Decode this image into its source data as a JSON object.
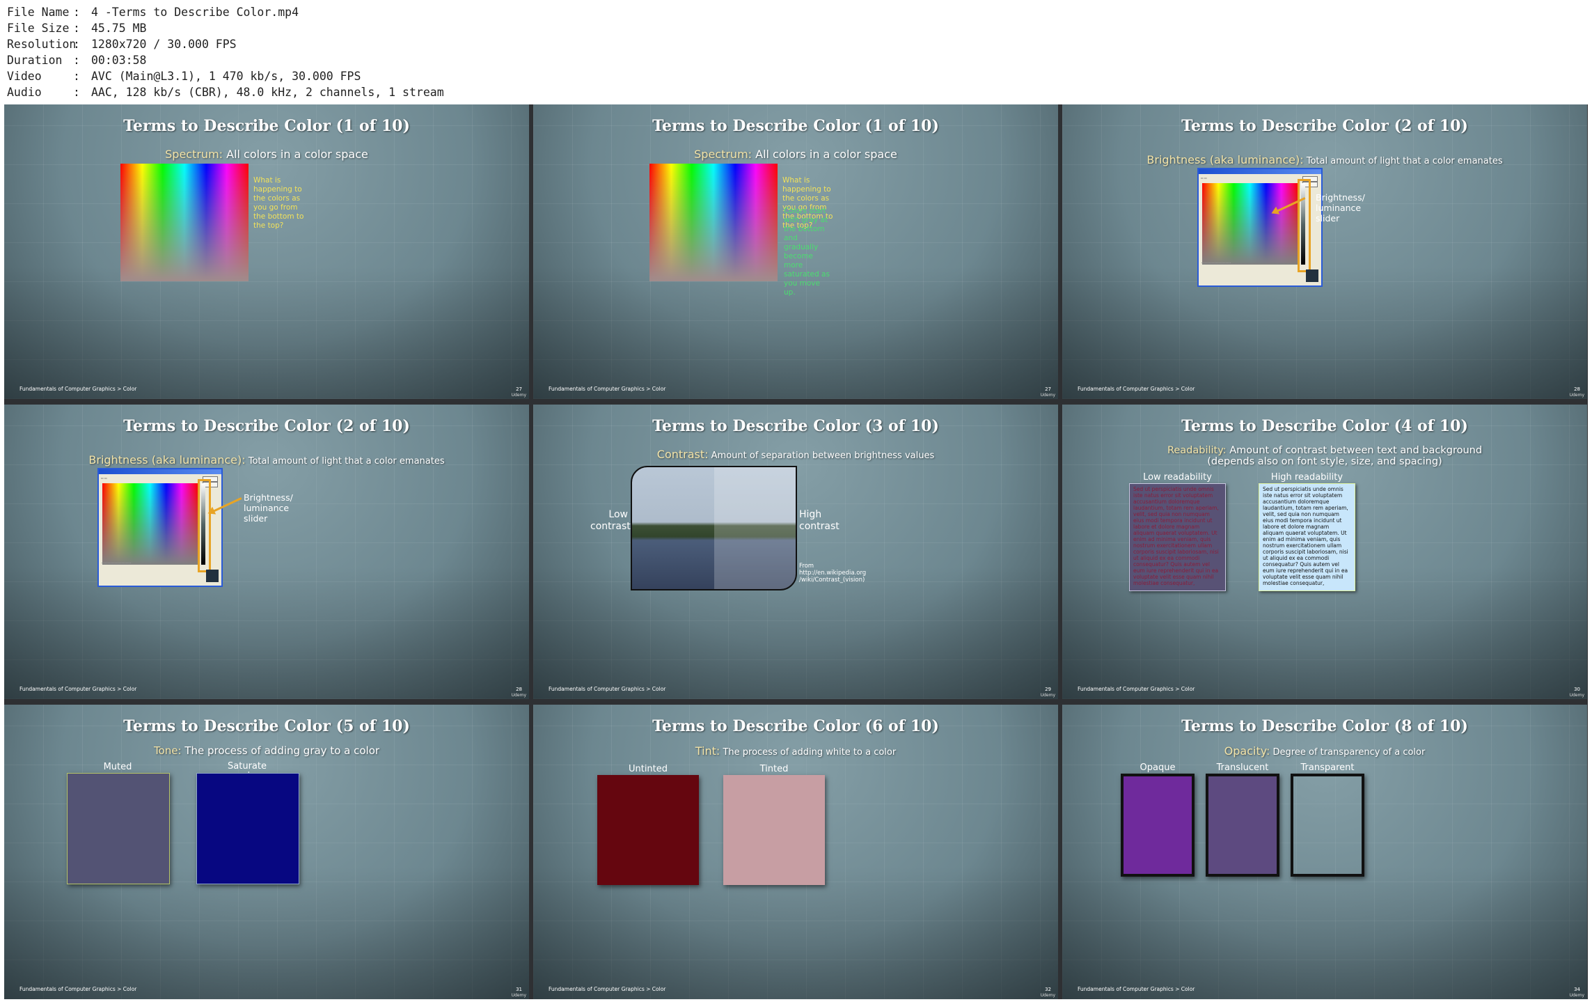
{
  "file_info": [
    {
      "key": "File Name",
      "value": "4 -Terms to Describe Color.mp4"
    },
    {
      "key": "File Size",
      "value": "45.75 MB"
    },
    {
      "key": "Resolution",
      "value": "1280x720 / 30.000 FPS"
    },
    {
      "key": "Duration",
      "value": "00:03:58"
    },
    {
      "key": "Video",
      "value": "AVC (Main@L3.1), 1 470 kb/s, 30.000 FPS"
    },
    {
      "key": "Audio",
      "value": "AAC, 128 kb/s (CBR), 48.0 kHz, 2 channels, 1 stream"
    }
  ],
  "footer": "Fundamentals of Computer Graphics > Color",
  "brand": "Udemy",
  "slides": [
    {
      "title": "Terms to Describe Color (1 of 10)",
      "term": "Spectrum:",
      "desc": " All colors in a color space",
      "question": "What is happening to the colors as you go from the bottom to the top?",
      "page": "27"
    },
    {
      "title": "Terms to Describe Color (1 of 10)",
      "term": "Spectrum:",
      "desc": " All colors in a color space",
      "question": "What is happening to the colors as you go from the bottom to the top?",
      "answer": "Colors start with gray at the bottom and gradually become more saturated as you move up.",
      "page": "27"
    },
    {
      "title": "Terms to Describe Color (2 of 10)",
      "term": "Brightness (aka luminance):",
      "desc": " Total amount of light that a color emanates",
      "callout": "Brightness/ luminance slider",
      "page": "28"
    },
    {
      "title": "Terms to Describe Color (2 of 10)",
      "term": "Brightness (aka luminance):",
      "desc": " Total amount of light that a color emanates",
      "callout": "Brightness/ luminance slider",
      "page": "28"
    },
    {
      "title": "Terms to Describe Color (3 of 10)",
      "term": "Contrast:",
      "desc": " Amount of separation between brightness values",
      "left_label": "Low contrast",
      "right_label": "High contrast",
      "source": "From http://en.wikipedia.org /wiki/Contrast_(vision)",
      "page": "29"
    },
    {
      "title": "Terms to Describe Color (4 of 10)",
      "term": "Readability:",
      "desc": " Amount of contrast between text and background (depends also on font style, size, and spacing)",
      "low_label": "Low readability",
      "high_label": "High readability",
      "body_text": "Sed ut perspiciatis unde omnis iste natus error sit voluptatem accusantium doloremque laudantium, totam rem aperiam, velit, sed quia non numquam eius modi tempora incidunt ut labore et dolore magnam aliquam quaerat voluptatem. Ut enim ad minima veniam, quis nostrum exercitationem ullam corporis suscipit laboriosam, nisi ut aliquid ex ea commodi consequatur? Quis autem vel eum iure reprehenderit qui in ea voluptate velit esse quam nihil molestiae consequatur,",
      "page": "30"
    },
    {
      "title": "Terms to Describe Color (5 of 10)",
      "term": "Tone:",
      "desc": " The process of adding gray to a color",
      "left_label": "Muted",
      "right_label": "Saturate\nd",
      "left_color": "#535374",
      "right_color": "#070781",
      "page": "31"
    },
    {
      "title": "Terms to Describe Color (6 of 10)",
      "term": "Tint:",
      "desc": " The process of adding white to a color",
      "left_label": "Untinted",
      "right_label": "Tinted",
      "left_color": "#65060f",
      "right_color": "#c79ea3",
      "page": "32"
    },
    {
      "title": "Terms to Describe Color (8 of 10)",
      "term": "Opacity:",
      "desc": " Degree of transparency of a color",
      "labels": [
        "Opaque",
        "Translucent",
        "Transparent"
      ],
      "opaque_color": "#6f2a9c",
      "translucent_color": "#5d4a80",
      "page": "34"
    }
  ],
  "colors": {
    "term": "#f2e3a8",
    "question": "#f2e25a",
    "answer": "#4cdd70",
    "highlight": "#e8a425",
    "low_readability_bg": "#585275",
    "low_readability_text": "#8a1d3a",
    "high_readability_bg": "#c8e6fb"
  }
}
